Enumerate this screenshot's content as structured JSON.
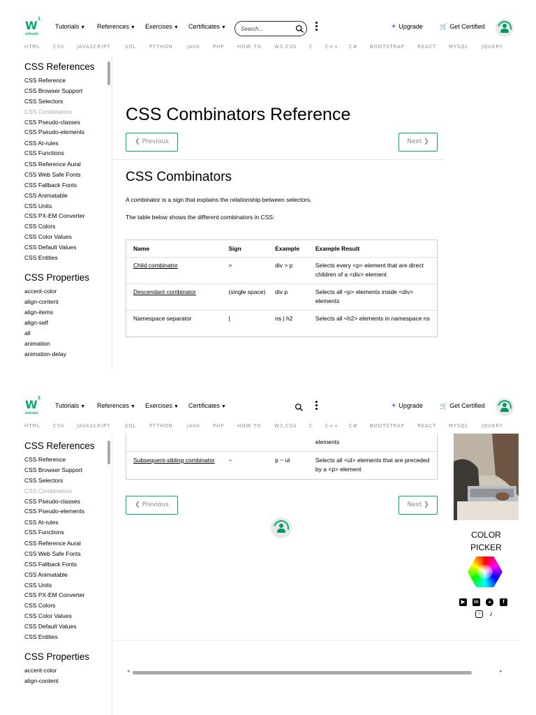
{
  "topnav": {
    "logo_mark": "W",
    "logo_sup": "3",
    "logo_sub": "schools",
    "menus": [
      "Tutorials",
      "References",
      "Exercises",
      "Certificates"
    ],
    "search_placeholder": "Search...",
    "upgrade": "Upgrade",
    "get_certified": "Get Certified"
  },
  "subnav": [
    "HTML",
    "CSS",
    "JAVASCRIPT",
    "SQL",
    "PYTHON",
    "JAVA",
    "PHP",
    "HOW TO",
    "W3.CSS",
    "C",
    "C++",
    "C#",
    "BOOTSTRAP",
    "REACT",
    "MYSQL",
    "JQUERY"
  ],
  "sidebar": {
    "references_heading": "CSS References",
    "references": [
      "CSS Reference",
      "CSS Browser Support",
      "CSS Selectors",
      "CSS Combinators",
      "CSS Pseudo-classes",
      "CSS Pseudo-elements",
      "CSS At-rules",
      "CSS Functions",
      "CSS Reference Aural",
      "CSS Web Safe Fonts",
      "CSS Fallback Fonts",
      "CSS Animatable",
      "CSS Units",
      "CSS PX-EM Converter",
      "CSS Colors",
      "CSS Color Values",
      "CSS Default Values",
      "CSS Entities"
    ],
    "active_item": "CSS Combinators",
    "properties_heading": "CSS Properties",
    "properties": [
      "accent-color",
      "align-content",
      "align-items",
      "align-self",
      "all",
      "animation",
      "animation-delay"
    ]
  },
  "main": {
    "title": "CSS Combinators Reference",
    "previous": "❮ Previous",
    "next": "Next ❯",
    "subtitle": "CSS Combinators",
    "para1": "A combinator is a sign that explains the relationship between selectors.",
    "para2": "The table below shows the different combinators in CSS:",
    "table_headers": [
      "Name",
      "Sign",
      "Example",
      "Example Result"
    ],
    "table_rows": [
      [
        "Child combinator",
        ">",
        "div > p",
        "Selects every <p> element that are direct children of a <div> element"
      ],
      [
        "Descendant combinator",
        "(single space)",
        "div p",
        "Selects all <p> elements inside <div> elements"
      ],
      [
        "Namespace separator",
        "|",
        "ns | h2",
        "Selects all <h2> elements in namespace ns"
      ]
    ],
    "scrolled_row_tail": "elements",
    "scrolled_row": [
      "Subsequent-sibling combinator",
      "~",
      "p ~ ul",
      "Selects all <ul> elements that are preceded by a <p> element"
    ]
  },
  "right": {
    "color_picker_line1": "COLOR",
    "color_picker_line2": "PICKER",
    "social_icons": [
      "youtube-icon",
      "linkedin-icon",
      "discord-icon",
      "facebook-icon",
      "instagram-icon",
      "tiktok-icon"
    ]
  },
  "colors": {
    "brand_green": "#04aa6d",
    "upgrade_purple": "#9763f6",
    "subnav_gray": "#8a8f98"
  }
}
